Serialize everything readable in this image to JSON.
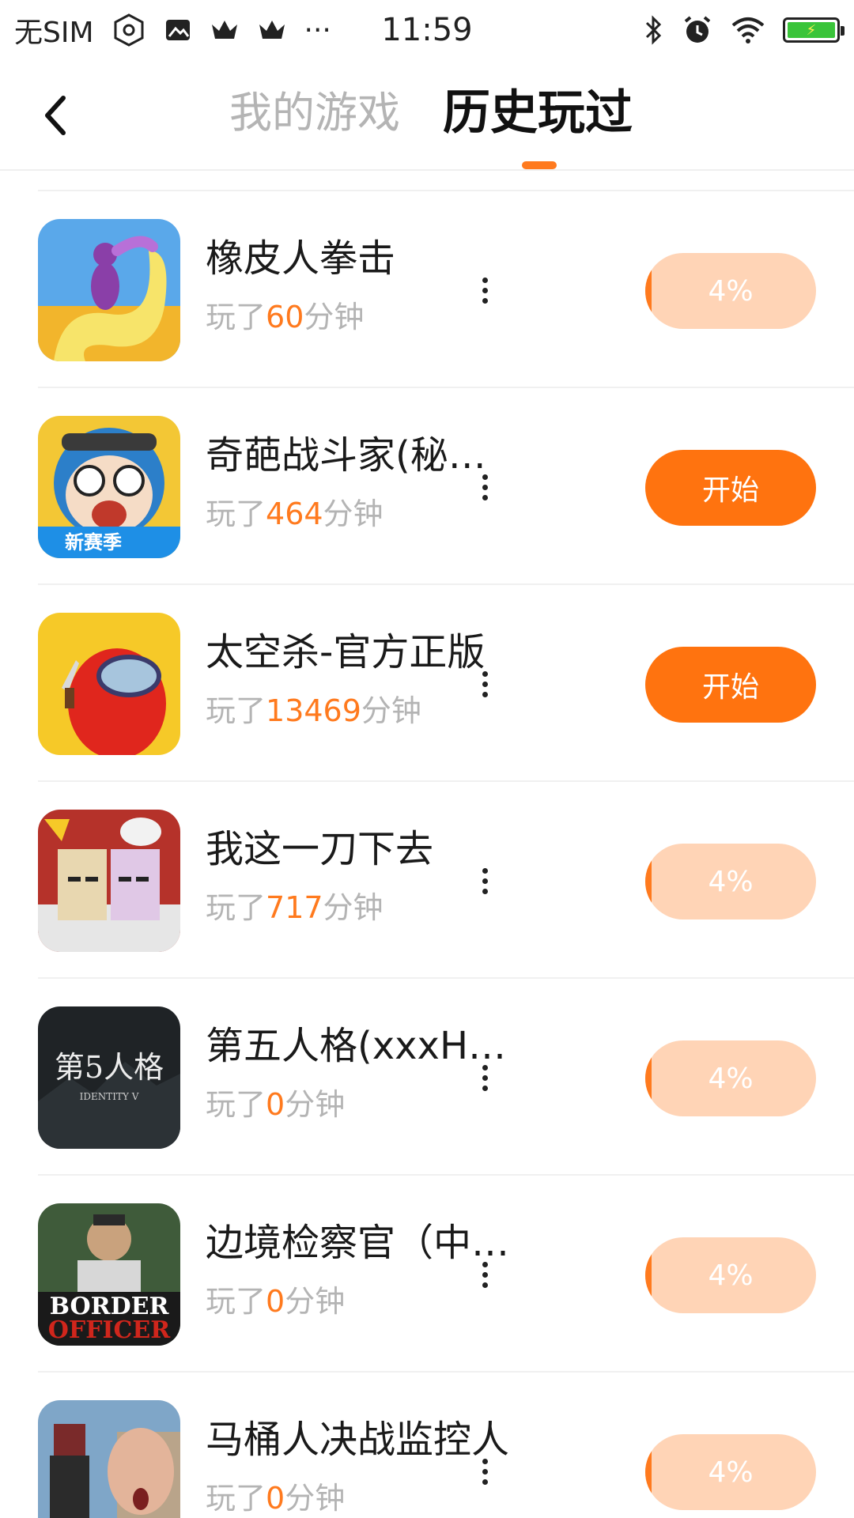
{
  "status_bar": {
    "carrier": "无SIM",
    "time": "11:59",
    "more": "···"
  },
  "header": {
    "tabs": [
      {
        "label": "我的游戏",
        "active": false
      },
      {
        "label": "历史玩过",
        "active": true
      }
    ]
  },
  "games": [
    {
      "title": "橡皮人拳击",
      "played_prefix": "玩了",
      "minutes": "60",
      "played_suffix": "分钟",
      "action": "4%",
      "action_type": "progress"
    },
    {
      "title": "奇葩战斗家(秘…",
      "played_prefix": "玩了",
      "minutes": "464",
      "played_suffix": "分钟",
      "action": "开始",
      "action_type": "start",
      "icon_text": "新赛季"
    },
    {
      "title": "太空杀-官方正版",
      "played_prefix": "玩了",
      "minutes": "13469",
      "played_suffix": "分钟",
      "action": "开始",
      "action_type": "start"
    },
    {
      "title": "我这一刀下去",
      "played_prefix": "玩了",
      "minutes": "717",
      "played_suffix": "分钟",
      "action": "4%",
      "action_type": "progress"
    },
    {
      "title": "第五人格(xxxH…",
      "played_prefix": "玩了",
      "minutes": "0",
      "played_suffix": "分钟",
      "action": "4%",
      "action_type": "progress",
      "icon_text": "第5人格",
      "icon_subtext": "IDENTITY V"
    },
    {
      "title": "边境检察官（中…",
      "played_prefix": "玩了",
      "minutes": "0",
      "played_suffix": "分钟",
      "action": "4%",
      "action_type": "progress",
      "icon_text": "BORDER",
      "icon_subtext": "OFFICER"
    },
    {
      "title": "马桶人决战监控人",
      "played_prefix": "玩了",
      "minutes": "0",
      "played_suffix": "分钟",
      "action": "4%",
      "action_type": "progress"
    }
  ],
  "colors": {
    "accent": "#ff7a1e",
    "start_button": "#ff730f",
    "progress_button": "#ffd4b6",
    "muted_text": "#b4b4b4"
  }
}
